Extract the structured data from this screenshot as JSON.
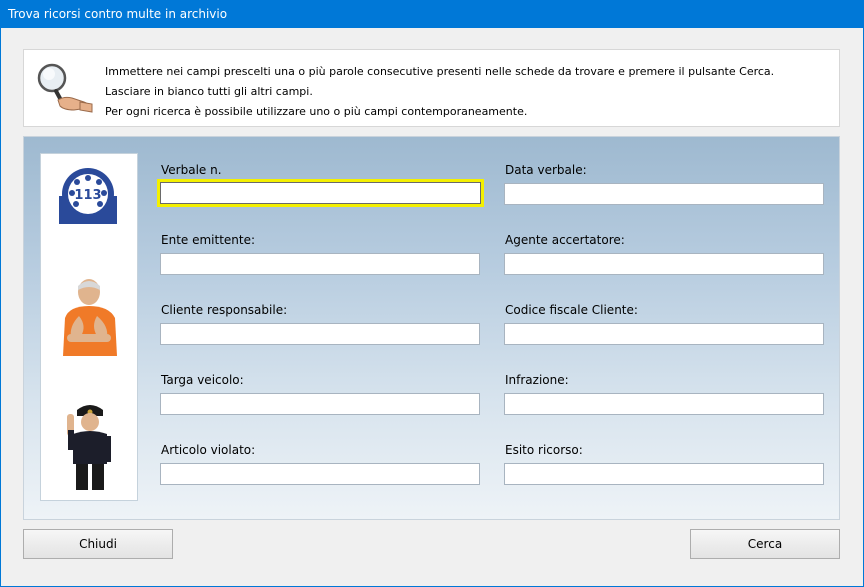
{
  "window": {
    "title": "Trova ricorsi contro multe in archivio"
  },
  "instructions": {
    "lines": [
      "Immettere nei campi prescelti una o più parole consecutive presenti nelle schede da trovare e premere il pulsante Cerca.",
      "Lasciare in bianco tutti gli altri campi.",
      "Per ogni ricerca è possibile utilizzare uno o più campi contemporaneamente."
    ]
  },
  "side_panel": {
    "badge_number": "113"
  },
  "fields": {
    "verbale_n": {
      "label": "Verbale n.",
      "value": ""
    },
    "data_verbale": {
      "label": "Data verbale:",
      "value": ""
    },
    "ente_emittente": {
      "label": "Ente emittente:",
      "value": ""
    },
    "agente_accertatore": {
      "label": "Agente accertatore:",
      "value": ""
    },
    "cliente_responsabile": {
      "label": "Cliente responsabile:",
      "value": ""
    },
    "codice_fiscale_cliente": {
      "label": "Codice fiscale Cliente:",
      "value": ""
    },
    "targa_veicolo": {
      "label": "Targa veicolo:",
      "value": ""
    },
    "infrazione": {
      "label": "Infrazione:",
      "value": ""
    },
    "articolo_violato": {
      "label": "Articolo violato:",
      "value": ""
    },
    "esito_ricorso": {
      "label": "Esito ricorso:",
      "value": ""
    }
  },
  "buttons": {
    "close_label": "Chiudi",
    "search_label": "Cerca"
  },
  "colors": {
    "titlebar": "#0078d7",
    "focus_border": "#f4f000",
    "badge_blue": "#2a4a9a"
  }
}
